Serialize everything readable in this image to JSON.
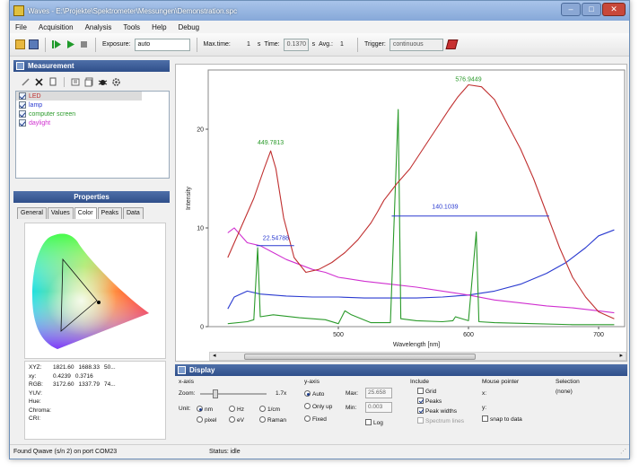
{
  "window": {
    "title": "Waves - E:\\Projekte\\Spektrometer\\Messungen\\Demonstration.spc",
    "minimize_glyph": "–",
    "maximize_glyph": "□",
    "close_glyph": "✕"
  },
  "menu": [
    "File",
    "Acquisition",
    "Analysis",
    "Tools",
    "Help",
    "Debug"
  ],
  "toolbar": {
    "exposure_label": "Exposure:",
    "exposure_value": "auto",
    "maxtime_label": "Max.time:",
    "maxtime_value": "1",
    "maxtime_unit": "s",
    "time_label": "Time:",
    "time_value": "0.1370",
    "time_unit": "s",
    "avg_label": "Avg.:",
    "avg_value": "1",
    "trigger_label": "Trigger:",
    "trigger_value": "continuous"
  },
  "measurement": {
    "header": "Measurement",
    "items": [
      {
        "label": "LED",
        "color": "#c03030",
        "selected": true
      },
      {
        "label": "lamp",
        "color": "#2a3ad0"
      },
      {
        "label": "computer screen",
        "color": "#2a9a2a"
      },
      {
        "label": "daylight",
        "color": "#d030d0"
      }
    ]
  },
  "properties": {
    "header": "Properties",
    "tabs": [
      "General",
      "Values",
      "Color",
      "Peaks",
      "Data"
    ],
    "active_tab": "Color",
    "color_rows": [
      {
        "k": "XYZ:",
        "v": [
          "1821.60",
          "1688.33",
          "50..."
        ]
      },
      {
        "k": "xy:",
        "v": [
          "0.4239",
          "0.3716"
        ]
      },
      {
        "k": "RGB:",
        "v": [
          "3172.60",
          "1337.79",
          "74..."
        ]
      },
      {
        "k": "YUV:",
        "v": []
      },
      {
        "k": "Hue:",
        "v": []
      },
      {
        "k": "Chroma:",
        "v": []
      },
      {
        "k": "CRI:",
        "v": []
      }
    ]
  },
  "chart_data": {
    "type": "line",
    "xlabel": "Wavelength [nm]",
    "ylabel": "Intensity",
    "xlim": [
      400,
      720
    ],
    "ylim": [
      0,
      26
    ],
    "xticks": [
      500,
      600,
      700
    ],
    "yticks": [
      0,
      10,
      20
    ],
    "grid": false,
    "series": [
      {
        "color": "#c03030",
        "points": [
          [
            415,
            7
          ],
          [
            425,
            10
          ],
          [
            435,
            13
          ],
          [
            443,
            16
          ],
          [
            448,
            17.8
          ],
          [
            452,
            16
          ],
          [
            458,
            11
          ],
          [
            466,
            7
          ],
          [
            475,
            5.5
          ],
          [
            485,
            5.8
          ],
          [
            495,
            6.5
          ],
          [
            505,
            7.5
          ],
          [
            515,
            8.8
          ],
          [
            525,
            10.5
          ],
          [
            530,
            11.6
          ],
          [
            535,
            12.8
          ],
          [
            545,
            14.5
          ],
          [
            555,
            16
          ],
          [
            565,
            18
          ],
          [
            575,
            20
          ],
          [
            585,
            22
          ],
          [
            592,
            23.3
          ],
          [
            600,
            24.5
          ],
          [
            610,
            24.3
          ],
          [
            620,
            23
          ],
          [
            630,
            20.5
          ],
          [
            640,
            18
          ],
          [
            650,
            15
          ],
          [
            660,
            11.5
          ],
          [
            670,
            8
          ],
          [
            680,
            5
          ],
          [
            690,
            3
          ],
          [
            700,
            1.5
          ],
          [
            712,
            0.8
          ]
        ]
      },
      {
        "color": "#2a3ad0",
        "points": [
          [
            415,
            1.8
          ],
          [
            420,
            3
          ],
          [
            430,
            3.6
          ],
          [
            440,
            3.3
          ],
          [
            460,
            3.1
          ],
          [
            480,
            3.0
          ],
          [
            500,
            3.0
          ],
          [
            520,
            2.9
          ],
          [
            540,
            2.9
          ],
          [
            560,
            2.9
          ],
          [
            580,
            3.0
          ],
          [
            600,
            3.2
          ],
          [
            620,
            3.6
          ],
          [
            640,
            4.3
          ],
          [
            660,
            5.4
          ],
          [
            675,
            6.5
          ],
          [
            690,
            8
          ],
          [
            700,
            9.2
          ],
          [
            712,
            9.8
          ]
        ]
      },
      {
        "color": "#2a9a2a",
        "points": [
          [
            415,
            0.3
          ],
          [
            430,
            0.5
          ],
          [
            435,
            0.7
          ],
          [
            438,
            8
          ],
          [
            440,
            1
          ],
          [
            450,
            1.2
          ],
          [
            470,
            0.9
          ],
          [
            490,
            0.7
          ],
          [
            500,
            0.3
          ],
          [
            505,
            1.6
          ],
          [
            510,
            1.2
          ],
          [
            525,
            0.4
          ],
          [
            540,
            0.4
          ],
          [
            546,
            22
          ],
          [
            548,
            0.8
          ],
          [
            560,
            0.6
          ],
          [
            580,
            0.5
          ],
          [
            588,
            0.6
          ],
          [
            590,
            1.0
          ],
          [
            600,
            0.6
          ],
          [
            606,
            9.6
          ],
          [
            608,
            0.5
          ],
          [
            620,
            0.4
          ],
          [
            650,
            0.3
          ],
          [
            680,
            0.2
          ],
          [
            712,
            0.2
          ]
        ]
      },
      {
        "color": "#d030d0",
        "points": [
          [
            415,
            9.5
          ],
          [
            420,
            10
          ],
          [
            430,
            8.5
          ],
          [
            440,
            8.2
          ],
          [
            450,
            7.5
          ],
          [
            460,
            6.8
          ],
          [
            470,
            6.3
          ],
          [
            480,
            5.8
          ],
          [
            490,
            5.5
          ],
          [
            500,
            5.0
          ],
          [
            520,
            4.6
          ],
          [
            540,
            4.3
          ],
          [
            560,
            4.0
          ],
          [
            580,
            3.6
          ],
          [
            600,
            3.2
          ],
          [
            620,
            2.7
          ],
          [
            640,
            2.4
          ],
          [
            660,
            2.1
          ],
          [
            680,
            1.9
          ],
          [
            700,
            1.6
          ],
          [
            712,
            1.4
          ]
        ]
      }
    ],
    "annotations": [
      {
        "text": "576.9449",
        "color": "#2a9a2a"
      },
      {
        "text": "449.7813",
        "color": "#2a9a2a"
      },
      {
        "text": "22.54788",
        "color": "#2a3ad0"
      },
      {
        "text": "140.1039",
        "color": "#2a3ad0"
      }
    ]
  },
  "display": {
    "header": "Display",
    "xaxis_title": "x-axis",
    "zoom_label": "Zoom:",
    "zoom_value": "1.7x",
    "zoom_fraction": 0.2,
    "unit_label": "Unit:",
    "units": [
      "nm",
      "Hz",
      "1/cm",
      "pixel",
      "eV",
      "Raman"
    ],
    "selected_unit": "nm",
    "yaxis_title": "y-axis",
    "y_modes": [
      "Auto",
      "Only up",
      "Fixed"
    ],
    "selected_y_mode": "Auto",
    "max_label": "Max:",
    "max_value": "25.658",
    "min_label": "Min:",
    "min_value": "0.003",
    "log_label": "Log",
    "include_title": "Include",
    "include_items": [
      {
        "label": "Grid",
        "checked": false
      },
      {
        "label": "Peaks",
        "checked": true
      },
      {
        "label": "Peak widths",
        "checked": true
      },
      {
        "label": "Spectrum lines",
        "checked": false
      }
    ],
    "mouse_title": "Mouse pointer",
    "mouse_x": "x:",
    "mouse_y": "y:",
    "snap_label": "snap to data",
    "selection_title": "Selection",
    "selection_value": "(none)"
  },
  "status": {
    "left": "Found Qwave (s/n 2) on port COM23",
    "right": "Status: idle"
  },
  "colors": {
    "accent": "#2f4f8a",
    "title": "#86a8d8"
  }
}
